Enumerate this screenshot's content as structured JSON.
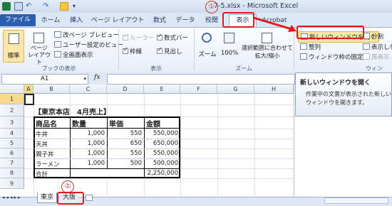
{
  "window": {
    "title": "7-5.xlsx - Microsoft Excel"
  },
  "quick_access": {
    "icons": [
      "excel-logo-icon",
      "save-icon",
      "undo-icon",
      "redo-icon",
      "open-icon",
      "quick-access-dropdown-icon"
    ]
  },
  "tabs": [
    "ファイル",
    "ホーム",
    "挿入",
    "ページ レイアウト",
    "数式",
    "データ",
    "校閲",
    "表示",
    "Acrobat"
  ],
  "ribbon": {
    "workbook_views": {
      "normal": "標準",
      "page_layout": "ページ レイアウト",
      "page_break": "改ページ プレビュー",
      "custom_views": "ユーザー設定のビュー",
      "full_screen": "全画面表示",
      "group_label": "ブックの表示"
    },
    "show": {
      "ruler": "ルーラー",
      "gridlines": "枠線",
      "formula_bar": "数式バー",
      "headings": "見出し",
      "group_label": "表示"
    },
    "zoom": {
      "zoom": "ズーム",
      "zoom100": "100%",
      "zoom_selection_1": "選択範囲に合わせて",
      "zoom_selection_2": "拡大/縮小",
      "group_label": "ズーム"
    },
    "window": {
      "new_window": "新しいウィンドウを開く",
      "arrange": "整列",
      "freeze": "ウィンドウ枠の固定",
      "split": "分割",
      "hide": "表示しな",
      "unhide": "再表示",
      "group_label": "ウィン"
    }
  },
  "formula_bar": {
    "name_box": "A1",
    "fx": "fx",
    "content": ""
  },
  "tooltip": {
    "title": "新しいウィンドウを開く",
    "body_1": "作業中の文書が表示された新しい",
    "body_2": "ウィンドウを開きます。"
  },
  "columns": [
    "A",
    "B",
    "C",
    "D",
    "E",
    "F",
    "G",
    "H"
  ],
  "rows": [
    "1",
    "2",
    "3",
    "4",
    "5",
    "6",
    "7",
    "8",
    "9"
  ],
  "sheet": {
    "title": "【東京本店　4月売上】",
    "headers": [
      "商品名",
      "数量",
      "単価",
      "金額"
    ],
    "data": [
      [
        "牛丼",
        "1,000",
        "550",
        "550,000"
      ],
      [
        "天丼",
        "1,000",
        "650",
        "650,000"
      ],
      [
        "親子丼",
        "1,000",
        "550",
        "550,000"
      ],
      [
        "ラーメン",
        "1,000",
        "500",
        "500,000"
      ],
      [
        "合計",
        "",
        "",
        "2,250,000"
      ]
    ]
  },
  "sheet_tabs": [
    "東京",
    "大阪"
  ],
  "callouts": [
    "①",
    "②"
  ]
}
